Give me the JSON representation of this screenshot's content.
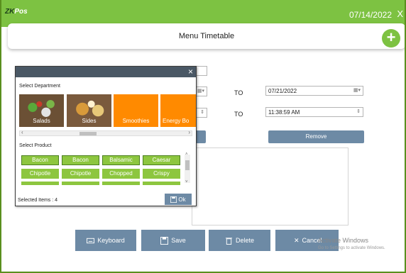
{
  "app": {
    "logo": "ZKPos",
    "logo_z": "ZK",
    "logo_rest": "Pos",
    "date": "07/14/2022",
    "close": "X"
  },
  "header": {
    "title": "Menu Timetable",
    "add": "+"
  },
  "form": {
    "date_to_value": "07/21/2022",
    "time_to_value": "11:38:59 AM",
    "to_label_1": "TO",
    "to_label_2": "TO",
    "remove_label": "Remove"
  },
  "actions": {
    "keyboard": "Keyboard",
    "save": "Save",
    "delete": "Delete",
    "cancel": "Cancel"
  },
  "watermark": {
    "title": "Activate Windows",
    "subtitle": "Go to Settings to activate Windows."
  },
  "dialog": {
    "close": "×",
    "department_label": "Select Department",
    "departments": [
      {
        "label": "Salads"
      },
      {
        "label": "Sides"
      },
      {
        "label": "Smoothies"
      },
      {
        "label": "Energy Bo"
      }
    ],
    "product_label": "Select Product",
    "products": [
      [
        "Bacon",
        "Bacon",
        "Balsamic",
        "Caesar"
      ],
      [
        "Chipotle",
        "Chipotle",
        "Chopped",
        "Crispy"
      ]
    ],
    "selected_items": "Selected Items : 4",
    "ok": "Ok"
  },
  "colors": {
    "brand_green": "#7dc242",
    "button_blue_grey": "#6d8aa5",
    "orange": "#ff8a00",
    "dialog_bar": "#4a5865"
  }
}
